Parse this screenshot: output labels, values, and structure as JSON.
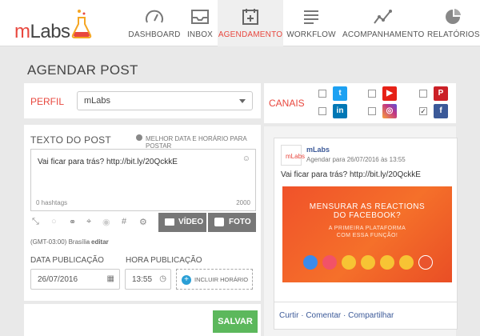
{
  "app": {
    "logo_text": "mLabs"
  },
  "nav": [
    {
      "label": "DASHBOARD",
      "icon": "gauge-icon"
    },
    {
      "label": "INBOX",
      "icon": "inbox-tray-icon"
    },
    {
      "label": "AGENDAMENTO",
      "icon": "calendar-plus-icon",
      "active": true
    },
    {
      "label": "WORKFLOW",
      "icon": "list-lines-icon"
    },
    {
      "label": "ACOMPANHAMENTO",
      "icon": "line-chart-icon"
    },
    {
      "label": "RELATÓRIOS",
      "icon": "pie-chart-icon"
    }
  ],
  "page_title": "AGENDAR POST",
  "profile": {
    "label": "PERFIL",
    "selected": "mLabs"
  },
  "channels": {
    "label": "CANAIS",
    "items": [
      {
        "name": "twitter",
        "checked": false,
        "color": "#1da1f2",
        "glyph": "t"
      },
      {
        "name": "youtube",
        "checked": false,
        "color": "#e62117",
        "glyph": "▶"
      },
      {
        "name": "pinterest",
        "checked": false,
        "color": "#cb2027",
        "glyph": "P"
      },
      {
        "name": "linkedin",
        "checked": false,
        "color": "#0077b5",
        "glyph": "in"
      },
      {
        "name": "instagram",
        "checked": false,
        "color": "#c13584",
        "glyph": "◎"
      },
      {
        "name": "facebook",
        "checked": true,
        "color": "#3b5998",
        "glyph": "f"
      }
    ]
  },
  "post": {
    "heading": "TEXTO DO POST",
    "best_time": "MELHOR DATA E HORÁRIO PARA POSTAR",
    "text": "Vai ficar para trás? http://bit.ly/20QckkE",
    "hashtags": "0 hashtags",
    "char_limit": "2000",
    "video_label": "VÍDEO",
    "photo_label": "FOTO",
    "timezone": "(GMT-03:00) Brasília",
    "edit_link": "editar"
  },
  "schedule": {
    "date_label": "DATA PUBLICAÇÃO",
    "time_label": "HORA PUBLICAÇÃO",
    "date_value": "26/07/2016",
    "time_value": "13:55",
    "add_time_label": "INCLUIR HORÁRIO"
  },
  "save_label": "SALVAR",
  "preview": {
    "name": "mLabs",
    "schedule_text": "Agendar para 26/07/2016 às 13:55",
    "text": "Vai ficar para trás? http://bit.ly/20QckkE",
    "banner_title_1": "MENSURAR AS REACTIONS",
    "banner_title_2": "DO FACEBOOK?",
    "banner_sub_1": "A PRIMEIRA PLATAFORMA",
    "banner_sub_2": "COM ESSA FUNÇÃO!",
    "actions": "Curtir · Comentar · Compartilhar"
  }
}
